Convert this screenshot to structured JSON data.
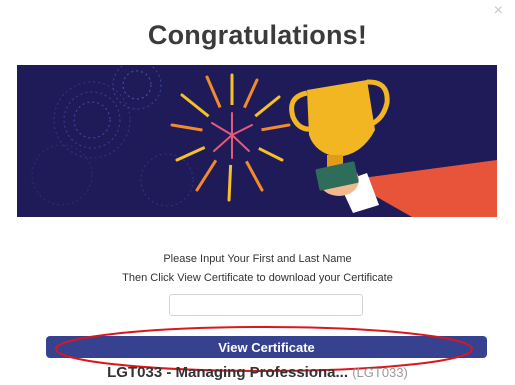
{
  "modal": {
    "close_symbol": "×",
    "title": "Congratulations!"
  },
  "banner": {
    "image": "fireworks-trophy-illustration",
    "colors": {
      "background": "#1f1b58",
      "trophy": "#f2b623",
      "sleeve": "#e8543a"
    }
  },
  "instructions": {
    "line1": "Please Input Your First and Last Name",
    "line2": "Then Click View Certificate to download your Certificate"
  },
  "name_input": {
    "value": "",
    "placeholder": ""
  },
  "view_button": {
    "label": "View Certificate",
    "color": "#36418f"
  },
  "annotation": {
    "shape": "ellipse",
    "color": "#d9181e"
  },
  "course": {
    "title": "LGT033 - Managing Professiona...",
    "code": "(LGT033)"
  }
}
